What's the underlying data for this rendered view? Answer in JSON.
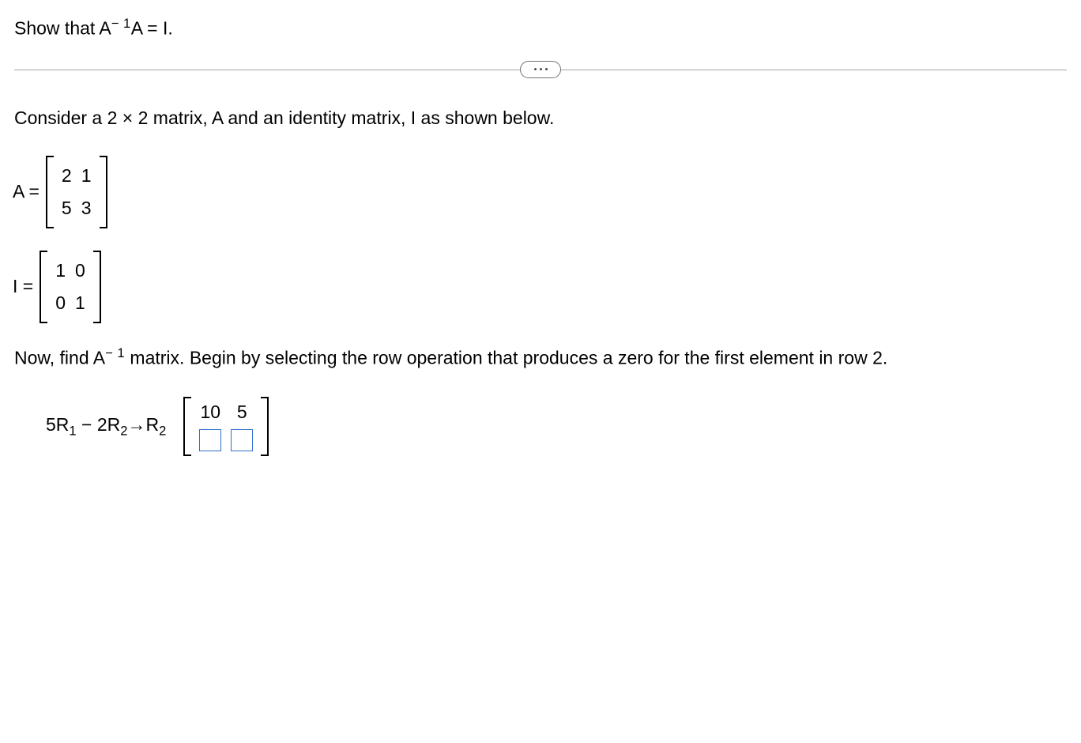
{
  "header": {
    "problem_pre": "Show that A",
    "exponent": "− 1",
    "problem_post": "A = I."
  },
  "divider": {
    "semantic": "expand-ellipsis"
  },
  "body": {
    "consider": "Consider a 2 × 2 matrix, A and an identity matrix, I as shown below.",
    "matA": {
      "label": "A =",
      "r1c1": "2",
      "r1c2": "1",
      "r2c1": "5",
      "r2c2": "3"
    },
    "matI": {
      "label": "I =",
      "r1c1": "1",
      "r1c2": "0",
      "r2c1": "0",
      "r2c2": "1"
    },
    "nowfind_pre": "Now, find A",
    "nowfind_exp": "− 1",
    "nowfind_post": " matrix. Begin by selecting the row operation that produces a zero for the first element in row 2.",
    "rowop": {
      "part1": "5R",
      "s1": "1",
      "part2": " − 2R",
      "s2": "2",
      "arrow": "→",
      "part3": "R",
      "s3": "2"
    },
    "result": {
      "r1c1": "10",
      "r1c2": "5"
    }
  }
}
